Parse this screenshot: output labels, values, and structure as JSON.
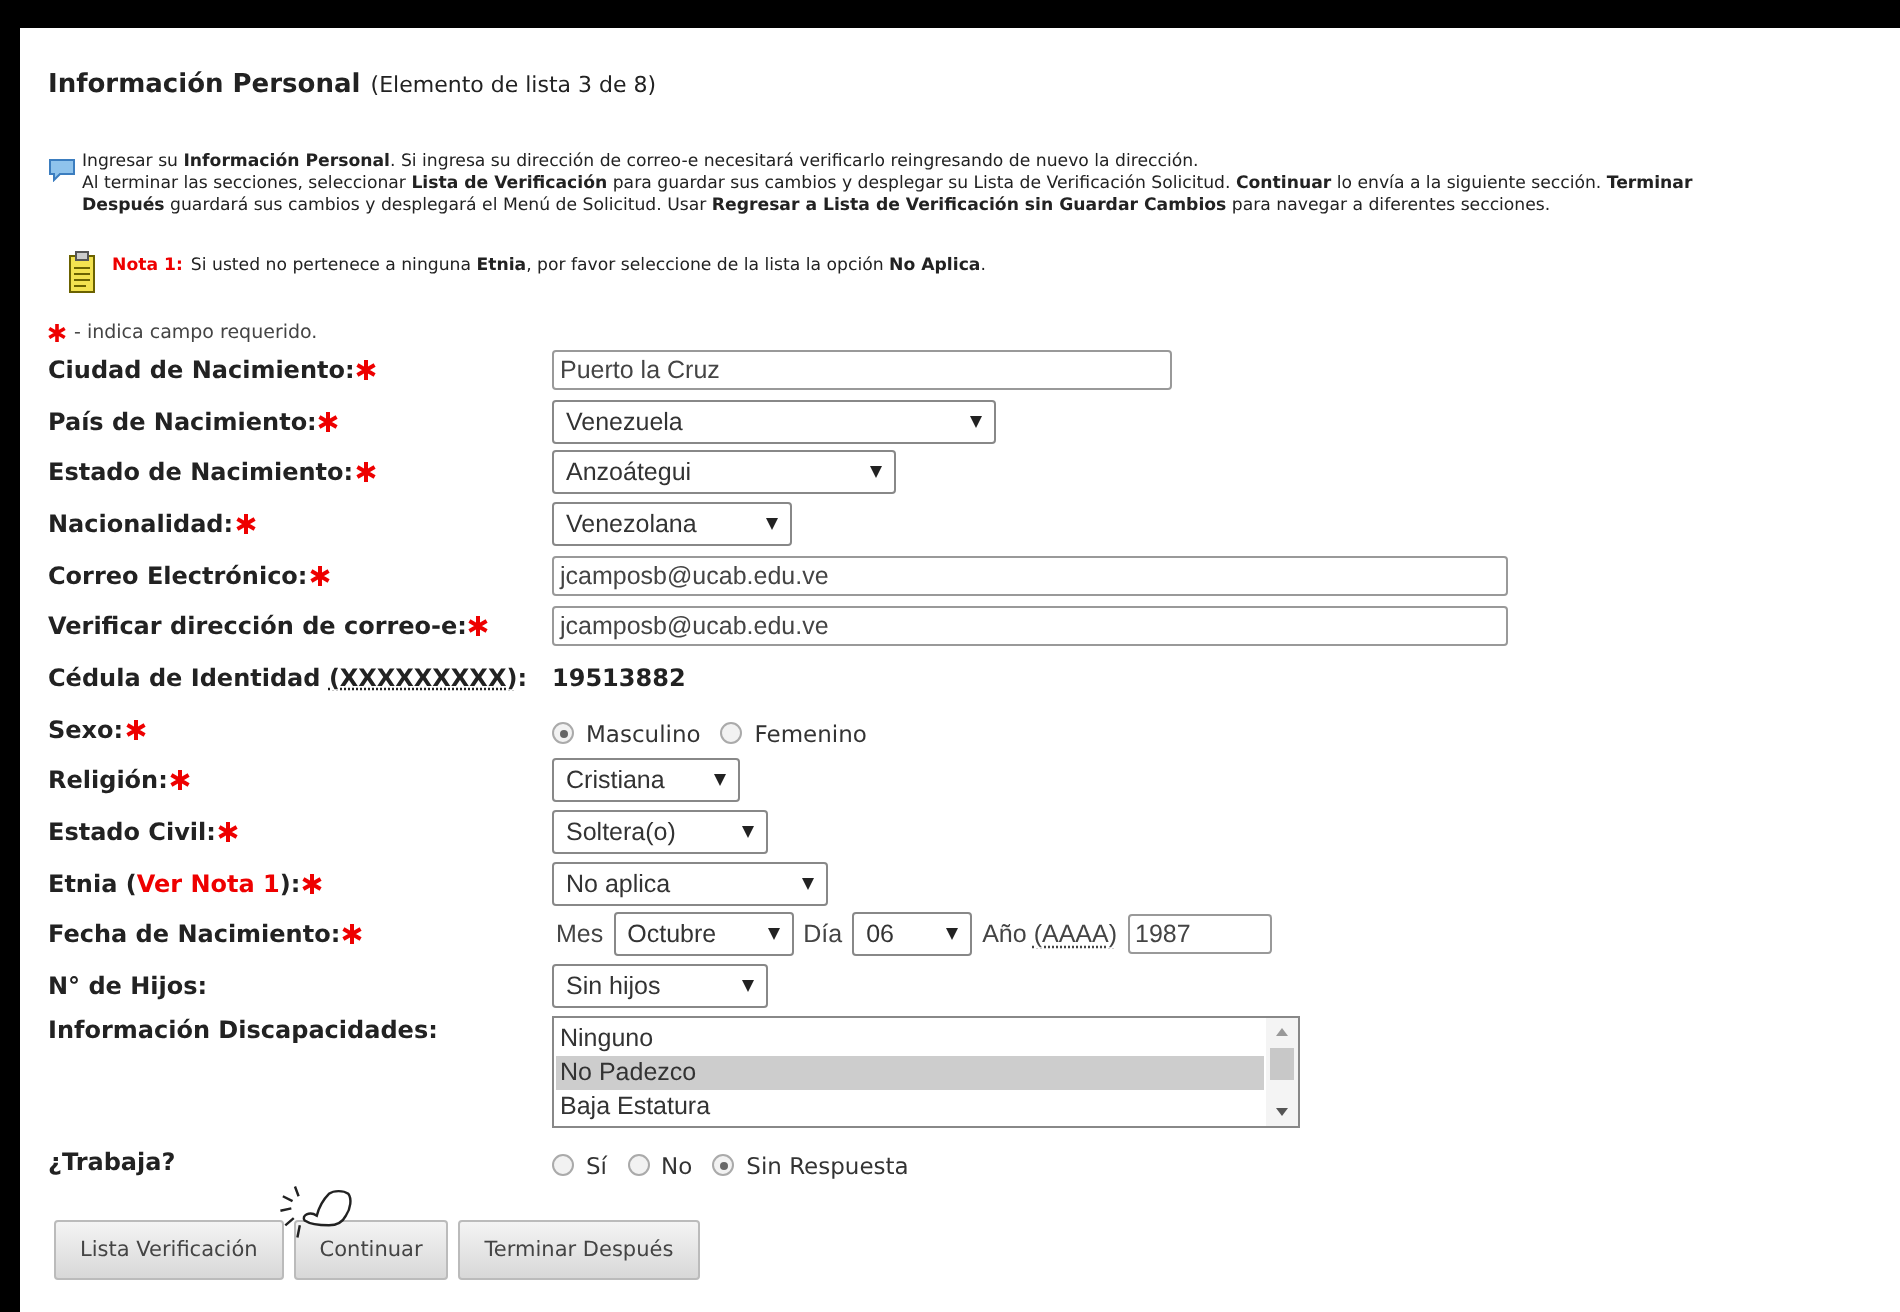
{
  "header": {
    "title": "Información Personal",
    "subtitle": "(Elemento de lista 3 de 8)"
  },
  "info": {
    "lines": [
      "Ingresar su **Información Personal**. Si ingresa su dirección de correo-e necesitará verificarlo reingresando de nuevo la dirección.",
      "Al terminar las secciones, seleccionar **Lista de Verificación** para guardar sus cambios y desplegar su Lista de Verificación Solicitud. **Continuar** lo envía a la siguiente sección. **Terminar**",
      "**Después** guardará sus cambios y desplegará el Menú de Solicitud. Usar **Regresar a Lista de Verificación sin Guardar Cambios** para navegar a diferentes secciones."
    ]
  },
  "note": {
    "label": "Nota 1:",
    "text": "Si usted no pertenece a ninguna **Etnia**, por favor seleccione de la lista la opción **No Aplica**."
  },
  "required_hint": "- indica campo requerido.",
  "fields": [
    {
      "kind": "text",
      "label": "Ciudad de Nacimiento:",
      "required": true,
      "value": "Puerto la Cruz"
    },
    {
      "kind": "select",
      "label": "País de Nacimiento:",
      "required": true,
      "value": "Venezuela"
    },
    {
      "kind": "select",
      "label": "Estado de Nacimiento:",
      "required": true,
      "value": "Anzoátegui"
    },
    {
      "kind": "select",
      "label": "Nacionalidad:",
      "required": true,
      "value": "Venezolana"
    },
    {
      "kind": "text",
      "label": "Correo Electrónico:",
      "required": true,
      "value": "jcamposb@ucab.edu.ve"
    },
    {
      "kind": "text",
      "label": "Verificar dirección de correo-e:",
      "required": true,
      "value": "jcamposb@ucab.edu.ve"
    },
    {
      "kind": "static",
      "label": "Cédula de Identidad",
      "abbr": "(XXXXXXXXX)",
      "suffix": ":",
      "required": false,
      "value": "19513882"
    },
    {
      "kind": "radio",
      "label": "Sexo:",
      "required": true,
      "options": [
        {
          "label": "Masculino",
          "selected": true
        },
        {
          "label": "Femenino",
          "selected": false
        }
      ]
    },
    {
      "kind": "select",
      "label": "Religión:",
      "required": true,
      "value": "Cristiana"
    },
    {
      "kind": "select",
      "label": "Estado Civil:",
      "required": true,
      "value": "Soltera(o)"
    },
    {
      "kind": "select",
      "label": "Etnia (",
      "link": "Ver Nota 1",
      "suffix": "):",
      "required": true,
      "value": "No aplica"
    },
    {
      "kind": "date",
      "label": "Fecha de Nacimiento:",
      "required": true,
      "parts": [
        {
          "kind": "caption",
          "text": "Mes"
        },
        {
          "kind": "select",
          "value": "Octubre"
        },
        {
          "kind": "caption",
          "text": "Día"
        },
        {
          "kind": "select",
          "value": "06"
        },
        {
          "kind": "caption",
          "text": "Año",
          "abbr": "(AAAA)"
        },
        {
          "kind": "text",
          "value": "1987"
        }
      ]
    },
    {
      "kind": "select",
      "label": "N° de Hijos:",
      "required": false,
      "value": "Sin hijos"
    },
    {
      "kind": "listbox",
      "label": "Información Discapacidades:",
      "required": false,
      "options": [
        {
          "label": "Ninguno",
          "selected": false
        },
        {
          "label": "No Padezco",
          "selected": true
        },
        {
          "label": "Baja Estatura",
          "selected": false
        }
      ]
    },
    {
      "kind": "radio",
      "label": "¿Trabaja?",
      "required": false,
      "options": [
        {
          "label": "Sí",
          "selected": false
        },
        {
          "label": "No",
          "selected": false
        },
        {
          "label": "Sin Respuesta",
          "selected": true
        }
      ]
    }
  ],
  "buttons": [
    {
      "label": "Lista Verificación"
    },
    {
      "label": "Continuar"
    },
    {
      "label": "Terminar Después"
    }
  ]
}
